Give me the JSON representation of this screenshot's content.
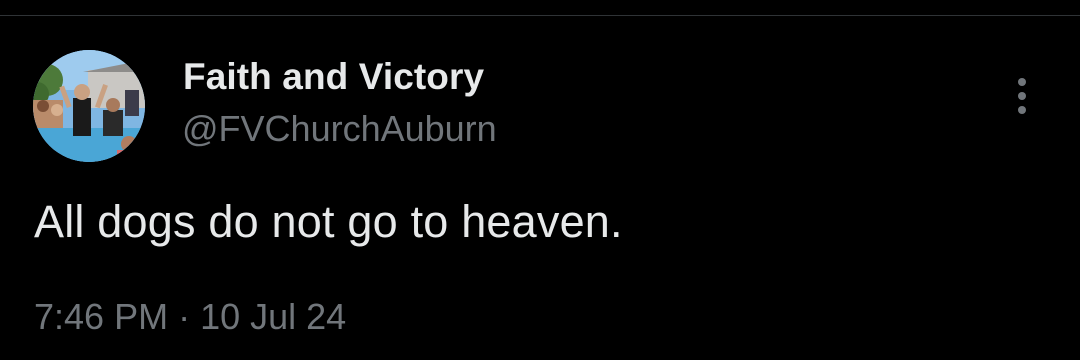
{
  "tweet": {
    "author": {
      "display_name": "Faith and Victory",
      "handle": "@FVChurchAuburn",
      "avatar_icon": "profile-photo"
    },
    "text": "All dogs do not go to heaven.",
    "time": "7:46 PM",
    "separator": "·",
    "date": "10 Jul 24",
    "more_icon": "more-vertical-icon"
  },
  "colors": {
    "background": "#000000",
    "primary_text": "#e7e9ea",
    "secondary_text": "#71767b",
    "divider": "#2f3336"
  }
}
